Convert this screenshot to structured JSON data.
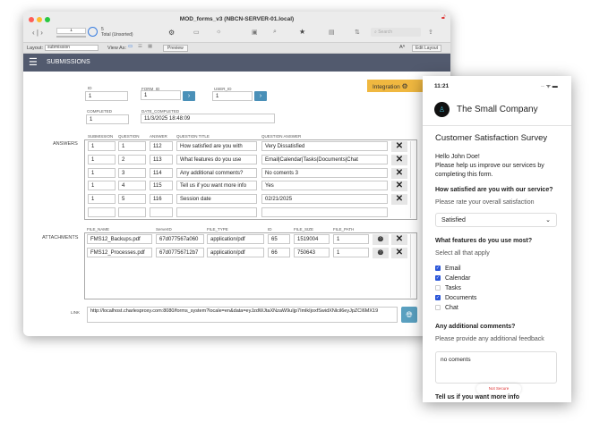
{
  "window": {
    "title": "MOD_forms_v3 (NBCN-SERVER-01.local)",
    "record": "1",
    "found": "5",
    "total_label": "Total (Unsorted)",
    "search_placeholder": "Search",
    "layout_label": "Layout:",
    "layout_value": "submission",
    "view_as": "View As:",
    "preview": "Preview",
    "edit_layout": "Edit Layout"
  },
  "header": {
    "title": "SUBMISSIONS",
    "integration": "Integration"
  },
  "record": {
    "id_label": "ID",
    "id": "1",
    "form_id_label": "FORM_ID",
    "form_id": "1",
    "user_id_label": "USER_ID",
    "user_id": "1",
    "completed_label": "COMPLETED",
    "completed": "1",
    "date_completed_label": "DATE_COMPLETED",
    "date_completed": "11/3/2025 18:48:09"
  },
  "answers": {
    "label": "ANSWERS",
    "columns": [
      "SUBMISSION",
      "QUESTION",
      "ANSWER",
      "QUESTION TITLE",
      "QUESTION ANSWER"
    ],
    "rows": [
      [
        "1",
        "1",
        "112",
        "How satisfied are you with",
        "Very Dissatisfied"
      ],
      [
        "1",
        "2",
        "113",
        "What features do you use",
        "Email|Calendar|Tasks|Documents|Chat"
      ],
      [
        "1",
        "3",
        "114",
        "Any additional comments?",
        "No coments 3"
      ],
      [
        "1",
        "4",
        "115",
        "Tell us if you want more info",
        "Yes"
      ],
      [
        "1",
        "5",
        "116",
        "Session date",
        "02/21/2025"
      ]
    ]
  },
  "attachments": {
    "label": "ATTACHMENTS",
    "columns": [
      "FILE_NAME",
      "ServerID",
      "FILE_TYPE",
      "ID",
      "FILE_SIZE",
      "FILE_PATH"
    ],
    "rows": [
      [
        "FMS12_Backups.pdf",
        "67d077567a060",
        "application/pdf",
        "65",
        "1519004",
        "1"
      ],
      [
        "FMS12_Processes.pdf",
        "67d07756712b7",
        "application/pdf",
        "66",
        "750643",
        "1"
      ]
    ]
  },
  "link": {
    "label": "LINK",
    "value": "http://localhost.charlesproxy.com:8080/forms_system?locale=en&data=eyJzdWJtaXNzaW9uIjp7ImlkIjoxfSwidXNlcil6eyJpZCI6MX19"
  },
  "phone": {
    "time": "11:21",
    "company": "The Small Company",
    "survey_title": "Customer Satisfaction Survey",
    "greeting": "Hello John Doe!",
    "intro": "Please help us improve our services by completing this form.",
    "q1": "How satisfied are you with our service?",
    "q1_hint": "Please rate your overall satisfaction",
    "q1_value": "Satisfied",
    "q2": "What features do you use most?",
    "q2_hint": "Select all that apply",
    "options": [
      {
        "label": "Email",
        "checked": true
      },
      {
        "label": "Calendar",
        "checked": true
      },
      {
        "label": "Tasks",
        "checked": false
      },
      {
        "label": "Documents",
        "checked": true
      },
      {
        "label": "Chat",
        "checked": false
      }
    ],
    "q3": "Any additional comments?",
    "q3_hint": "Please provide any additional feedback",
    "q3_value": "no coments",
    "not_secure": "Not Secure",
    "q4": "Tell us if you want more info"
  },
  "colors": {
    "header": "#525a6e",
    "integration": "#f0b840",
    "accent": "#4a90b8",
    "checkbox": "#2a55d8"
  }
}
